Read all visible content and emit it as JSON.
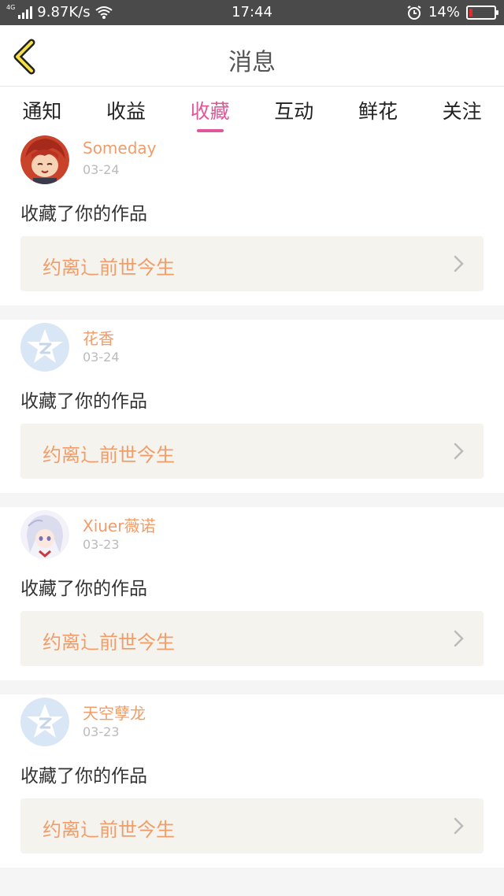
{
  "status": {
    "network_type": "4G",
    "speed": "9.87K/s",
    "time": "17:44",
    "battery": "14%",
    "battery_level": 0.14
  },
  "header": {
    "title": "消息"
  },
  "tabs": [
    {
      "label": "通知"
    },
    {
      "label": "收益"
    },
    {
      "label": "收藏"
    },
    {
      "label": "互动"
    },
    {
      "label": "鲜花"
    },
    {
      "label": "关注"
    }
  ],
  "active_tab": "收藏",
  "messages": [
    {
      "username": "Someday",
      "date": "03-24",
      "action": "收藏了你的作品",
      "work_title": "约离辶前世今生",
      "avatar_icon": "anime-red-hair-avatar"
    },
    {
      "username": "花香",
      "date": "03-24",
      "action": "收藏了你的作品",
      "work_title": "约离辶前世今生",
      "avatar_icon": "qq-default-avatar"
    },
    {
      "username": "Xiuer薇诺",
      "date": "03-23",
      "action": "收藏了你的作品",
      "work_title": "约离辶前世今生",
      "avatar_icon": "anime-white-hair-avatar"
    },
    {
      "username": "天空孽龙",
      "date": "03-23",
      "action": "收藏了你的作品",
      "work_title": "约离辶前世今生",
      "avatar_icon": "qq-default-avatar"
    }
  ]
}
